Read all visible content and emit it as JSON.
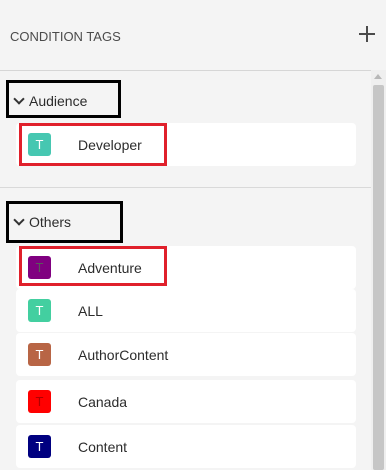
{
  "header": {
    "title": "CONDITION TAGS",
    "add_icon": "plus-icon"
  },
  "groups": [
    {
      "label": "Audience",
      "expanded": true,
      "tags": [
        {
          "letter": "T",
          "label": "Developer",
          "color": "#46c7b1"
        }
      ]
    },
    {
      "label": "Others",
      "expanded": true,
      "tags": [
        {
          "letter": "T",
          "label": "Adventure",
          "color": "#800080"
        },
        {
          "letter": "T",
          "label": "ALL",
          "color": "#43cfa0"
        },
        {
          "letter": "T",
          "label": "AuthorContent",
          "color": "#b86545"
        },
        {
          "letter": "T",
          "label": "Canada",
          "color": "#ff0000"
        },
        {
          "letter": "T",
          "label": "Content",
          "color": "#000080"
        }
      ]
    }
  ],
  "colors": {
    "highlight_red": "#e0202b",
    "highlight_black": "#000000",
    "panel_bg": "#f4f4f4",
    "row_bg": "#ffffff"
  }
}
